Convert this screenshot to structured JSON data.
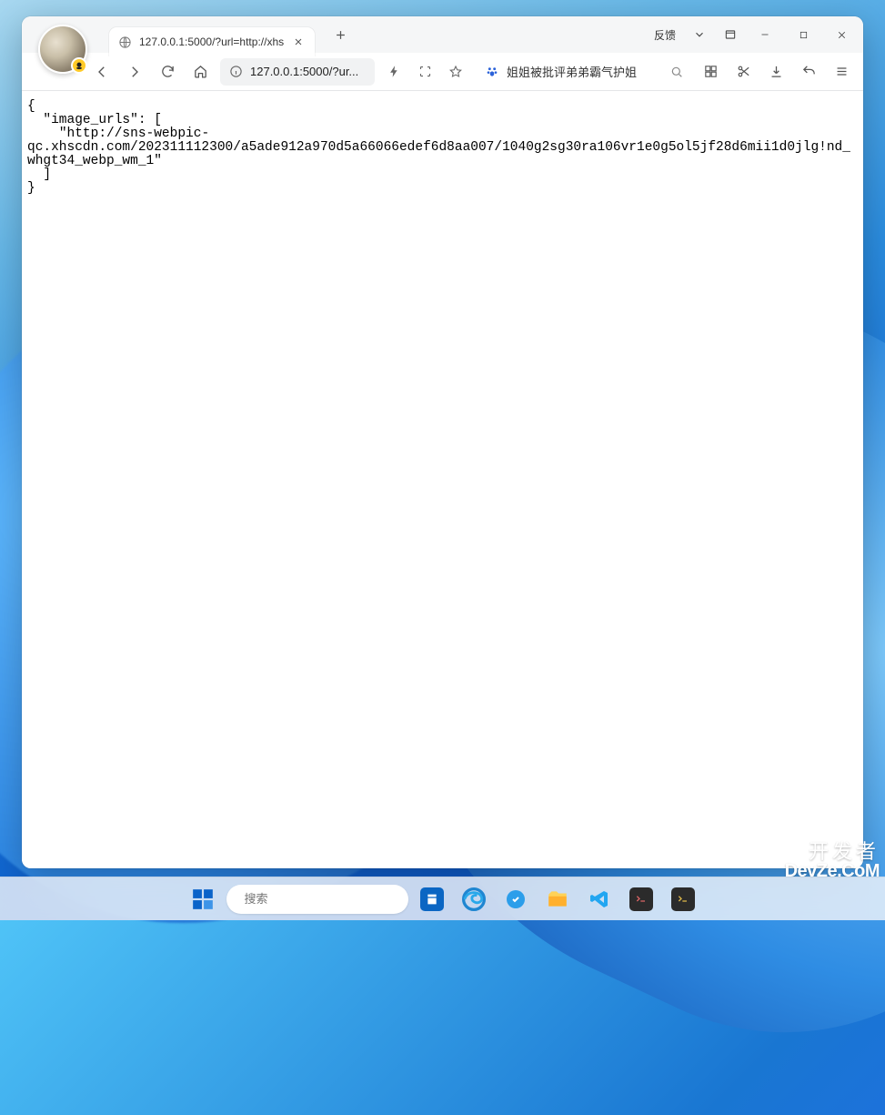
{
  "titlebar": {
    "tab_title": "127.0.0.1:5000/?url=http://xhs",
    "feedback_label": "反馈"
  },
  "addrbar": {
    "url_display": "127.0.0.1:5000/?ur...",
    "search_suggestion": "姐姐被批评弟弟霸气护姐"
  },
  "content": {
    "json_text": "{\n  \"image_urls\": [\n    \"http://sns-webpic-\nqc.xhscdn.com/202311112300/a5ade912a970d5a66066edef6d8aa007/1040g2sg30ra106vr1e0g5ol5jf28d6mii1d0jlg!nd_whgt34_webp_wm_1\"\n  ]\n}"
  },
  "taskbar": {
    "search_placeholder": "搜索"
  },
  "watermark": {
    "cn": "开发者",
    "en": "DevZe.CoM"
  }
}
